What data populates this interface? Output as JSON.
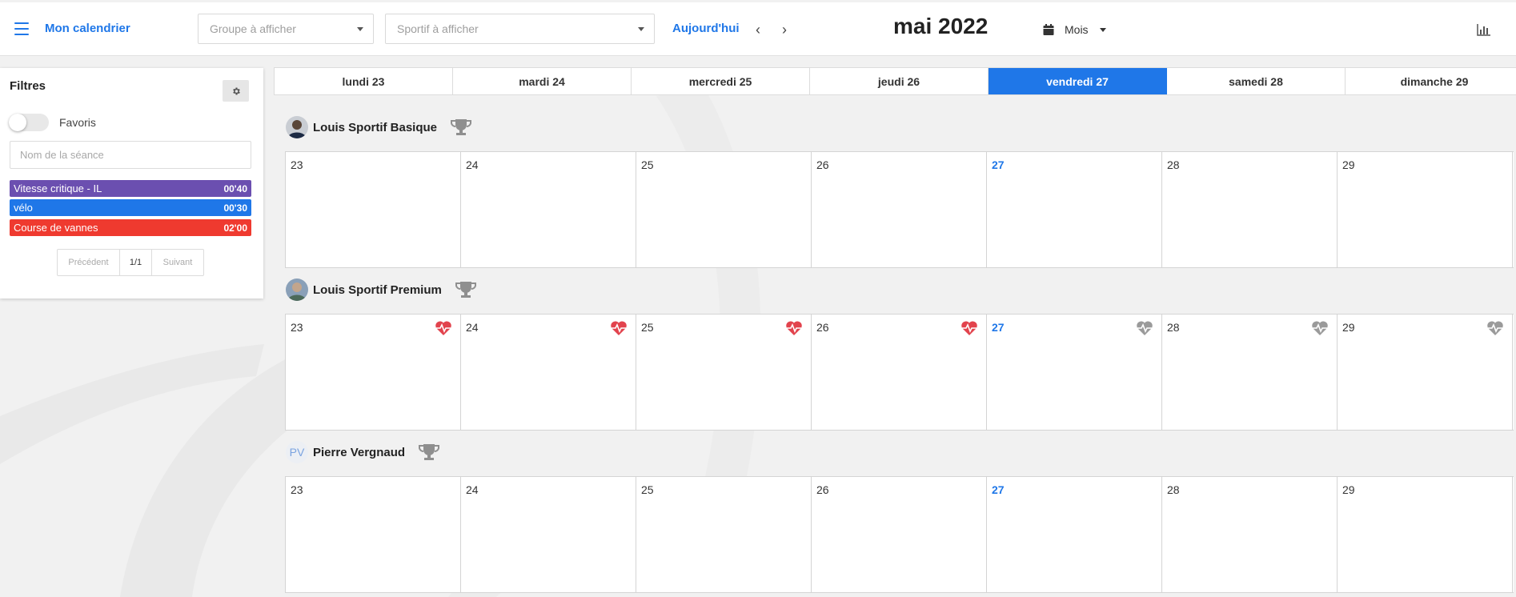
{
  "header": {
    "brand": "Mon calendrier",
    "group_placeholder": "Groupe à afficher",
    "athlete_placeholder": "Sportif à afficher",
    "today": "Aujourd'hui",
    "prev_glyph": "‹",
    "next_glyph": "›",
    "month_title": "mai 2022",
    "view": "Mois",
    "icons": [
      "menu-icon",
      "calendar-icon",
      "bar-chart-icon"
    ]
  },
  "filters": {
    "title": "Filtres",
    "favorites_label": "Favoris",
    "favorites_on": false,
    "search_placeholder": "Nom de la séance",
    "sessions": [
      {
        "name": "Vitesse critique - IL",
        "duration": "00'40",
        "color": "#6b4fb0"
      },
      {
        "name": "vélo",
        "duration": "00'30",
        "color": "#1f77e8"
      },
      {
        "name": "Course de vannes",
        "duration": "02'00",
        "color": "#ef3a2f"
      }
    ],
    "pager": {
      "prev": "Précédent",
      "page": "1/1",
      "next": "Suivant"
    }
  },
  "days": [
    {
      "label": "lundi 23",
      "num": "23"
    },
    {
      "label": "mardi 24",
      "num": "24"
    },
    {
      "label": "mercredi 25",
      "num": "25"
    },
    {
      "label": "jeudi 26",
      "num": "26"
    },
    {
      "label": "vendredi 27",
      "num": "27",
      "today": true
    },
    {
      "label": "samedi 28",
      "num": "28"
    },
    {
      "label": "dimanche 29",
      "num": "29"
    }
  ],
  "athletes": [
    {
      "name": "Louis Sportif Basique",
      "avatar": "photo",
      "hearts": []
    },
    {
      "name": "Louis Sportif Premium",
      "avatar": "photo",
      "hearts": [
        "red",
        "red",
        "red",
        "red",
        "gray",
        "gray",
        "gray"
      ]
    },
    {
      "name": "Pierre Vergnaud",
      "initials": "PV",
      "avatar": "initials",
      "hearts": []
    }
  ],
  "colors": {
    "accent": "#1f77e8",
    "heart_active": "#e2434d",
    "heart_inactive": "#9a9a9a",
    "trophy": "#8f8f8f"
  }
}
